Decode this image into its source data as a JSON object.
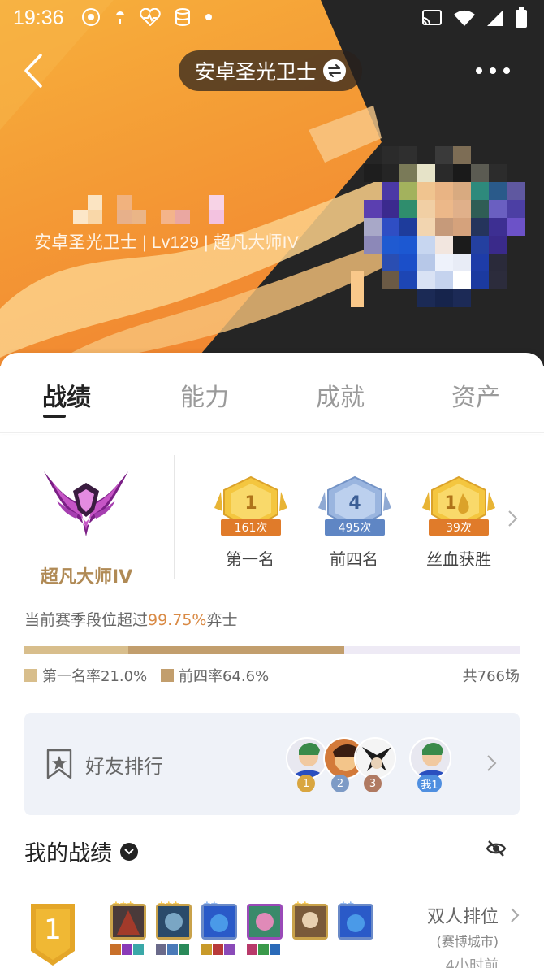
{
  "status_bar": {
    "time": "19:36"
  },
  "header": {
    "title": "安卓圣光卫士"
  },
  "profile": {
    "line": "安卓圣光卫士 | Lv129 | 超凡大师IV"
  },
  "tabs": [
    {
      "label": "战绩",
      "active": true
    },
    {
      "label": "能力",
      "active": false
    },
    {
      "label": "成就",
      "active": false
    },
    {
      "label": "资产",
      "active": false
    }
  ],
  "rank": {
    "name": "超凡大师IV"
  },
  "badges": [
    {
      "number": "1",
      "count": "161次",
      "label": "第一名"
    },
    {
      "number": "4",
      "count": "495次",
      "label": "前四名"
    },
    {
      "number": "1",
      "count": "39次",
      "label": "丝血获胜"
    }
  ],
  "season": {
    "prefix": "当前赛季段位超过",
    "percent": "99.75%",
    "suffix": "弈士"
  },
  "stats": {
    "first_rate_label": "第一名率21.0%",
    "first_rate": 0.21,
    "top4_rate_label": "前四率64.6%",
    "top4_rate": 0.646,
    "total": "共766场"
  },
  "friends": {
    "title": "好友排行",
    "ranks": [
      "1",
      "2",
      "3"
    ],
    "me_label": "我1"
  },
  "my_records": {
    "title": "我的战绩",
    "matches": [
      {
        "place": "1",
        "mode": "双人排位",
        "sub": "(赛博城市)",
        "time": "4小时前"
      }
    ]
  },
  "colors": {
    "accent": "#d98a45",
    "rank_gold": "#b08a55",
    "first_rate": "#d8be8c",
    "top4_rate": "#c29e6d",
    "friends_bg": "#eff2f8"
  }
}
